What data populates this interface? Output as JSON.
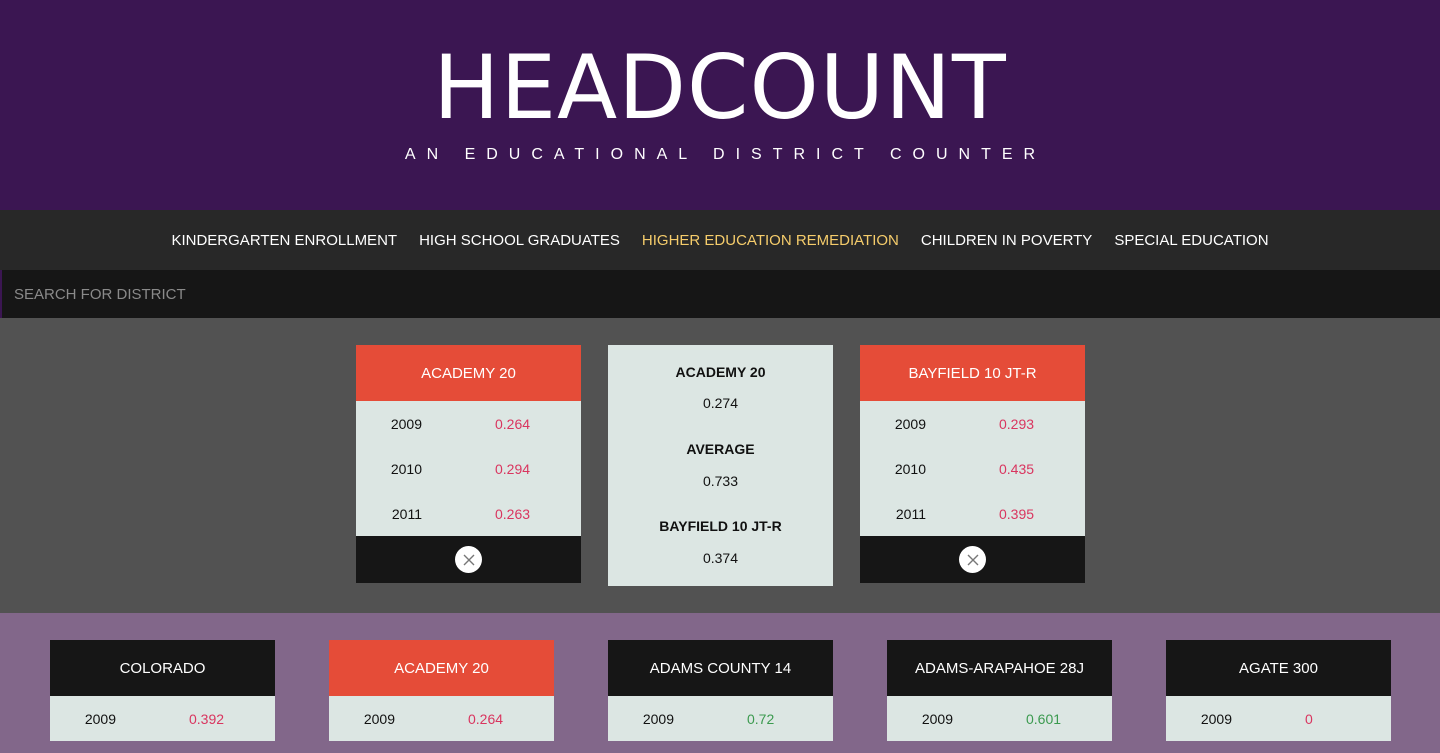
{
  "app": {
    "title": "HEADCOUNT",
    "subtitle": "AN EDUCATIONAL DISTRICT COUNTER"
  },
  "nav": {
    "items": [
      {
        "label": "KINDERGARTEN ENROLLMENT",
        "active": false
      },
      {
        "label": "HIGH SCHOOL GRADUATES",
        "active": false
      },
      {
        "label": "HIGHER EDUCATION REMEDIATION",
        "active": true
      },
      {
        "label": "CHILDREN IN POVERTY",
        "active": false
      },
      {
        "label": "SPECIAL EDUCATION",
        "active": false
      }
    ],
    "active_color": "#f5cc6b"
  },
  "search": {
    "placeholder": "SEARCH FOR DISTRICT",
    "value": ""
  },
  "compare": {
    "left": {
      "name": "ACADEMY 20",
      "rows": [
        {
          "year": "2009",
          "value": "0.264"
        },
        {
          "year": "2010",
          "value": "0.294"
        },
        {
          "year": "2011",
          "value": "0.263"
        }
      ]
    },
    "summary": {
      "first_label": "ACADEMY 20",
      "first_value": "0.274",
      "avg_label": "AVERAGE",
      "avg_value": "0.733",
      "second_label": "BAYFIELD 10 JT-R",
      "second_value": "0.374"
    },
    "right": {
      "name": "BAYFIELD 10 JT-R",
      "rows": [
        {
          "year": "2009",
          "value": "0.293"
        },
        {
          "year": "2010",
          "value": "0.435"
        },
        {
          "year": "2011",
          "value": "0.395"
        }
      ]
    }
  },
  "districts": [
    {
      "name": "COLORADO",
      "year": "2009",
      "value": "0.392"
    },
    {
      "name": "ACADEMY 20",
      "year": "2009",
      "value": "0.264"
    },
    {
      "name": "ADAMS COUNTY 14",
      "year": "2009",
      "value": "0.72"
    },
    {
      "name": "ADAMS-ARAPAHOE 28J",
      "year": "2009",
      "value": "0.601"
    },
    {
      "name": "AGATE 300",
      "year": "2009",
      "value": "0"
    }
  ],
  "colors": {
    "header_bg": "#3b1652",
    "selected_card_header": "#e54c38",
    "card_header": "#161616",
    "low_value": "#d9355f",
    "high_value": "#3b9a4f"
  },
  "icons": {
    "remove": "close-icon"
  }
}
